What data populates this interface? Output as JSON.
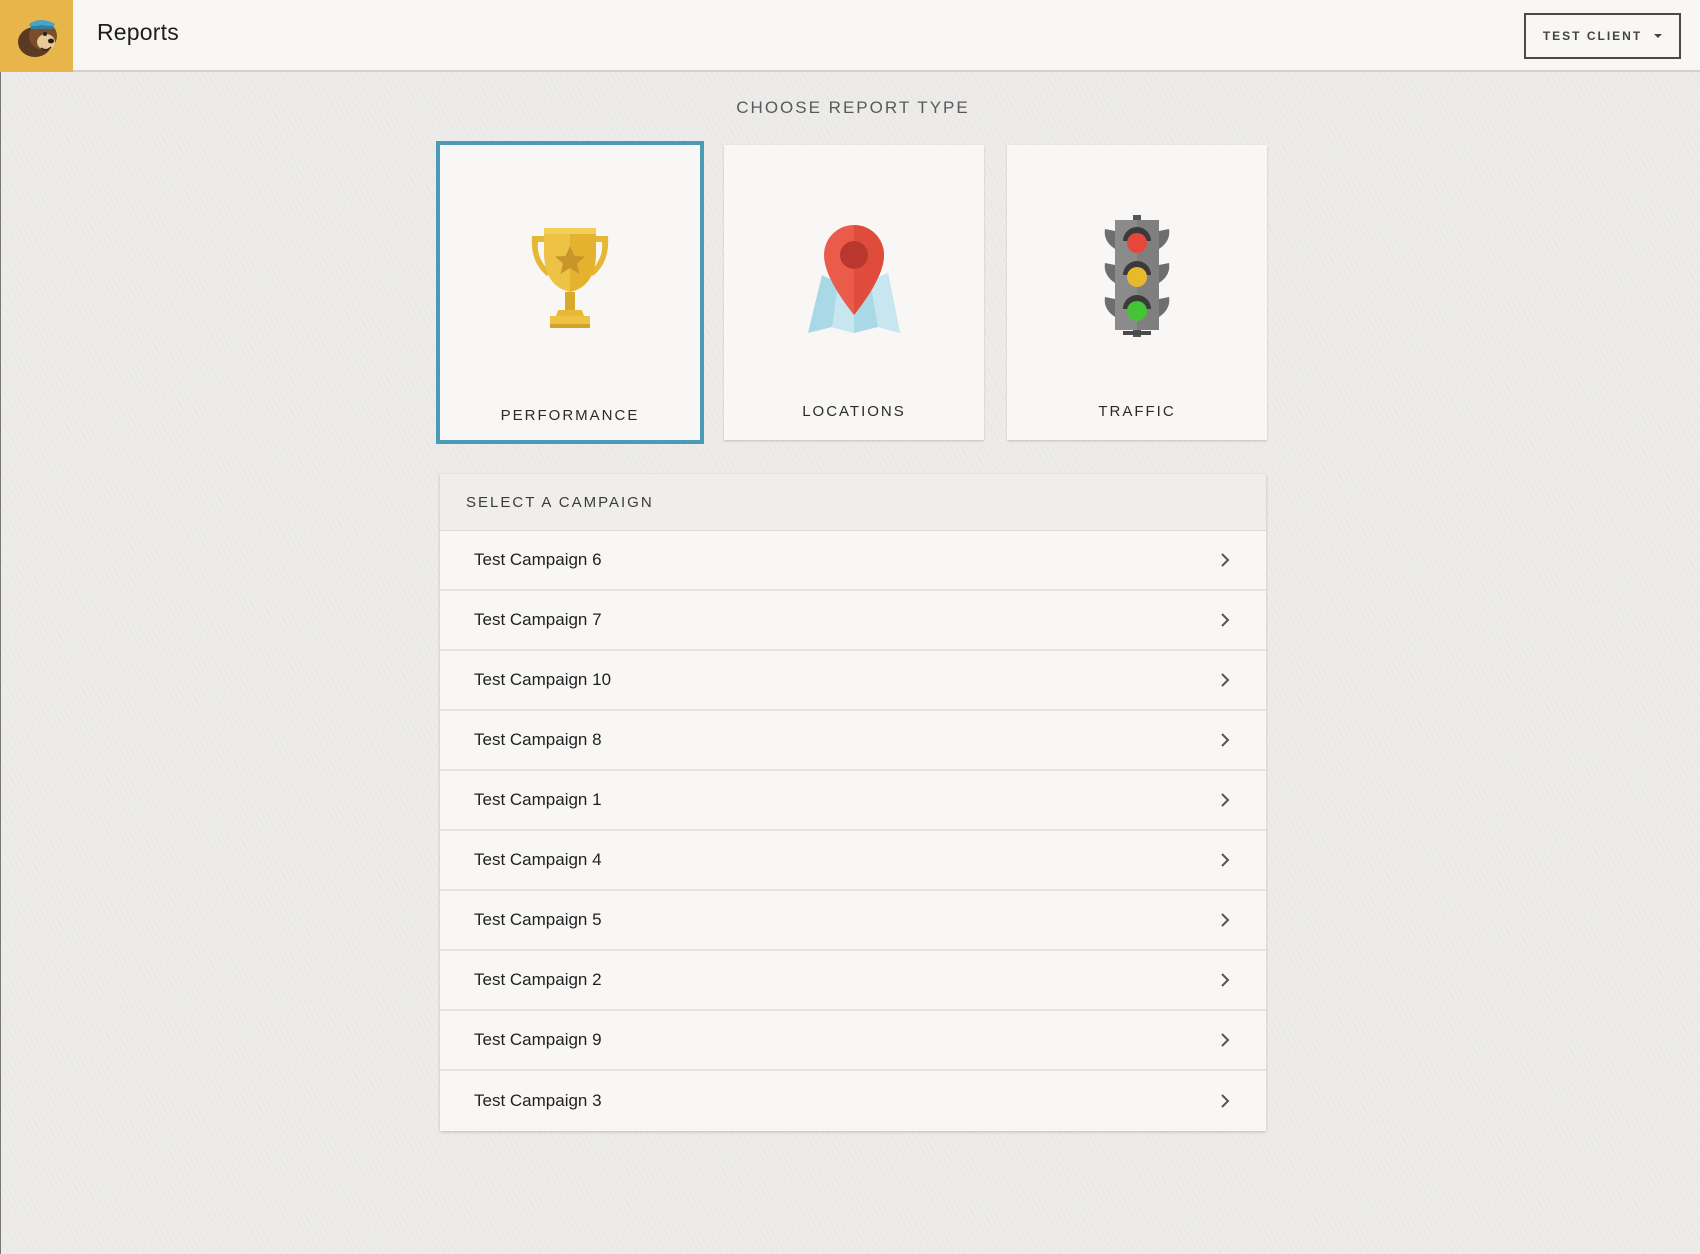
{
  "header": {
    "title": "Reports",
    "logo_icon": "mailchimp-freddie-logo",
    "client_button_label": "TEST CLIENT"
  },
  "report_types": {
    "title": "CHOOSE REPORT TYPE",
    "selected": "performance",
    "accent_color": "#4a9bb5",
    "items": [
      {
        "label": "PERFORMANCE",
        "icon": "trophy-icon"
      },
      {
        "label": "LOCATIONS",
        "icon": "map-pin-icon"
      },
      {
        "label": "TRAFFIC",
        "icon": "traffic-light-icon"
      }
    ]
  },
  "campaigns": {
    "header": "SELECT A CAMPAIGN",
    "items": [
      {
        "label": "Test Campaign 6"
      },
      {
        "label": "Test Campaign 7"
      },
      {
        "label": "Test Campaign 10"
      },
      {
        "label": "Test Campaign 8"
      },
      {
        "label": "Test Campaign 1"
      },
      {
        "label": "Test Campaign 4"
      },
      {
        "label": "Test Campaign 5"
      },
      {
        "label": "Test Campaign 2"
      },
      {
        "label": "Test Campaign 9"
      },
      {
        "label": "Test Campaign 3"
      }
    ]
  }
}
